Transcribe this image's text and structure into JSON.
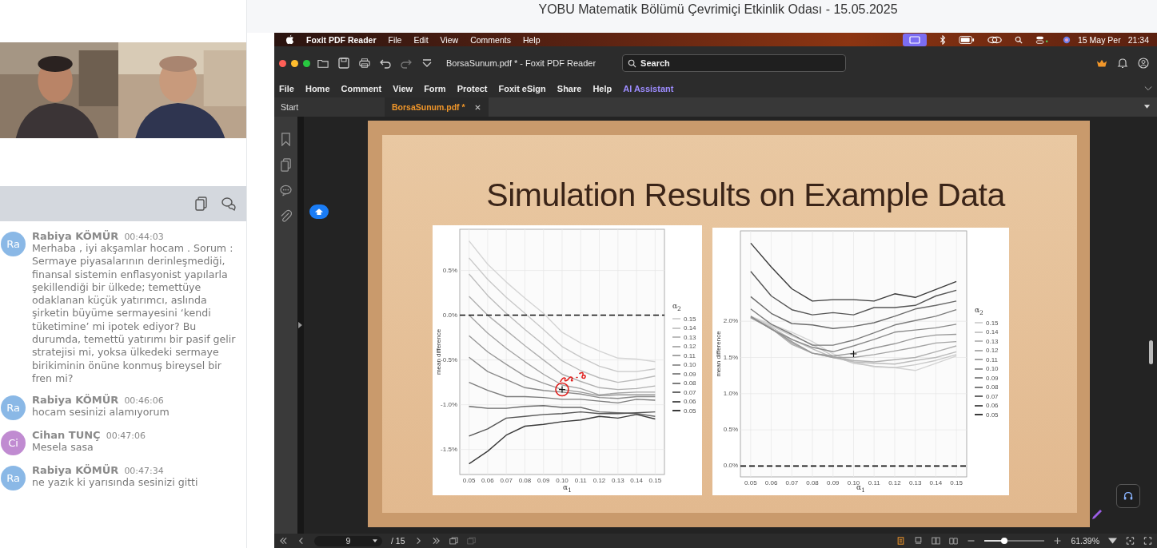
{
  "room_title": "YOBU Matematik Bölümü Çevrimiçi Etkinlik Odası - 15.05.2025",
  "chat": {
    "messages": [
      {
        "initials": "Ra",
        "color": "#8ab8e6",
        "name": "Rabiya KÖMÜR",
        "time": "00:44:03",
        "text": "Merhaba , iyi akşamlar hocam . Sorum : Sermaye piyasalarının derinleşmediği, finansal sistemin enflasyonist yapılarla şekillendiği bir ülkede; temettüye odaklanan küçük yatırımcı, aslında şirketin büyüme sermayesini ‘kendi tüketimine’ mi ipotek ediyor? Bu durumda, temettü yatırımı bir pasif gelir stratejisi mi, yoksa ülkedeki sermaye birikiminin önüne konmuş bireysel bir fren mi?"
      },
      {
        "initials": "Ra",
        "color": "#8ab8e6",
        "name": "Rabiya KÖMÜR",
        "time": "00:46:06",
        "text": "hocam sesinizi alamıyorum"
      },
      {
        "initials": "Ci",
        "color": "#c08bd1",
        "name": "Cihan TUNÇ",
        "time": "00:47:06",
        "text": "Mesela sasa"
      },
      {
        "initials": "Ra",
        "color": "#8ab8e6",
        "name": "Rabiya KÖMÜR",
        "time": "00:47:34",
        "text": "ne yazık ki yarısında sesinizi gitti"
      }
    ]
  },
  "shared_screen": {
    "mac_menu": {
      "app": "Foxit PDF Reader",
      "items": [
        "File",
        "Edit",
        "View",
        "Comments",
        "Help"
      ],
      "date": "15 May Per",
      "time": "21:34"
    },
    "window": {
      "title": "BorsaSunum.pdf * - Foxit PDF Reader",
      "search": {
        "placeholder": "Search"
      }
    },
    "ribbon": [
      {
        "label": "File",
        "kind": "menu"
      },
      {
        "label": "Home",
        "kind": "menu"
      },
      {
        "label": "Comment",
        "kind": "menu"
      },
      {
        "label": "View",
        "kind": "menu"
      },
      {
        "label": "Form",
        "kind": "menu"
      },
      {
        "label": "Protect",
        "kind": "menu"
      },
      {
        "label": "Foxit eSign",
        "kind": "menu"
      },
      {
        "label": "Share",
        "kind": "menu"
      },
      {
        "label": "Help",
        "kind": "menu"
      },
      {
        "label": "AI Assistant",
        "kind": "ai"
      }
    ],
    "tabs": [
      {
        "label": "Start",
        "selected": false,
        "closable": false
      },
      {
        "label": "BorsaSunum.pdf *",
        "selected": true,
        "closable": true
      }
    ],
    "slide": {
      "title": "Simulation Results on Example Data",
      "charts": [
        {
          "chart_data": {
            "type": "line",
            "xlabel": "α$_{1}$",
            "ylabel": "mean difference",
            "legend": true,
            "legend_title": "α$_{2}$",
            "grid": true,
            "ref_lines": [
              {
                "axis": "y",
                "value": 0
              }
            ],
            "x": [
              0.05,
              0.06,
              0.07,
              0.08,
              0.09,
              0.1,
              0.11,
              0.12,
              0.13,
              0.14,
              0.15
            ],
            "xlim": [
              0.045,
              0.155
            ],
            "ylim": [
              -1.78,
              0.96
            ],
            "xticks": [
              {
                "value": 0.05,
                "label": "0.05"
              },
              {
                "value": 0.06,
                "label": "0.06"
              },
              {
                "value": 0.07,
                "label": "0.07"
              },
              {
                "value": 0.08,
                "label": "0.08"
              },
              {
                "value": 0.09,
                "label": "0.09"
              },
              {
                "value": 0.1,
                "label": "0.10"
              },
              {
                "value": 0.11,
                "label": "0.11"
              },
              {
                "value": 0.12,
                "label": "0.12"
              },
              {
                "value": 0.13,
                "label": "0.13"
              },
              {
                "value": 0.14,
                "label": "0.14"
              },
              {
                "value": 0.15,
                "label": "0.15"
              }
            ],
            "yticks": [
              {
                "value": -1.5,
                "label": "-1.5%"
              },
              {
                "value": -1.0,
                "label": "-1.0%"
              },
              {
                "value": -0.5,
                "label": "-0.5%"
              },
              {
                "value": 0,
                "label": "0.0%"
              },
              {
                "value": 0.5,
                "label": "0.5%"
              }
            ],
            "series": [
              {
                "name": "0.15",
                "color": "#d4d4d4",
                "values": [
                  0.83,
                  0.57,
                  0.37,
                  0.19,
                  0.02,
                  -0.19,
                  -0.31,
                  -0.4,
                  -0.48,
                  -0.49,
                  -0.52
                ]
              },
              {
                "name": "0.14",
                "color": "#c8c8c8",
                "values": [
                  0.64,
                  0.4,
                  0.2,
                  0.02,
                  -0.16,
                  -0.35,
                  -0.47,
                  -0.57,
                  -0.63,
                  -0.63,
                  -0.6
                ]
              },
              {
                "name": "0.13",
                "color": "#bcbcbc",
                "values": [
                  0.46,
                  0.22,
                  0.02,
                  -0.16,
                  -0.33,
                  -0.51,
                  -0.62,
                  -0.7,
                  -0.75,
                  -0.72,
                  -0.68
                ]
              },
              {
                "name": "0.12",
                "color": "#b0b0b0",
                "values": [
                  0.21,
                  0.0,
                  -0.17,
                  -0.34,
                  -0.5,
                  -0.66,
                  -0.74,
                  -0.81,
                  -0.83,
                  -0.82,
                  -0.79
                ]
              },
              {
                "name": "0.11",
                "color": "#a4a4a4",
                "values": [
                  0.0,
                  -0.2,
                  -0.37,
                  -0.52,
                  -0.66,
                  -0.78,
                  -0.82,
                  -0.89,
                  -0.87,
                  -0.86,
                  -0.86
                ]
              },
              {
                "name": "0.10",
                "color": "#989898",
                "values": [
                  -0.23,
                  -0.41,
                  -0.55,
                  -0.68,
                  -0.76,
                  -0.83,
                  -0.86,
                  -0.9,
                  -0.89,
                  -0.89,
                  -0.89
                ]
              },
              {
                "name": "0.09",
                "color": "#8a8a8a",
                "values": [
                  -0.47,
                  -0.63,
                  -0.72,
                  -0.81,
                  -0.84,
                  -0.86,
                  -0.88,
                  -0.92,
                  -0.93,
                  -0.91,
                  -0.91
                ]
              },
              {
                "name": "0.08",
                "color": "#7c7c7c",
                "values": [
                  -0.75,
                  -0.84,
                  -0.91,
                  -0.91,
                  -0.92,
                  -0.94,
                  -0.94,
                  -0.96,
                  -0.98,
                  -0.94,
                  -0.95
                ]
              },
              {
                "name": "0.07",
                "color": "#6a6a6a",
                "values": [
                  -1.02,
                  -1.04,
                  -1.04,
                  -1.02,
                  -1.01,
                  -1.03,
                  -1.03,
                  -1.08,
                  -1.09,
                  -1.1,
                  -1.13
                ]
              },
              {
                "name": "0.06",
                "color": "#555555",
                "values": [
                  -1.35,
                  -1.27,
                  -1.15,
                  -1.13,
                  -1.11,
                  -1.1,
                  -1.08,
                  -1.1,
                  -1.1,
                  -1.09,
                  -1.08
                ]
              },
              {
                "name": "0.05",
                "color": "#3a3a3a",
                "values": [
                  -1.66,
                  -1.52,
                  -1.34,
                  -1.24,
                  -1.22,
                  -1.19,
                  -1.17,
                  -1.13,
                  -1.15,
                  -1.11,
                  -1.16
                ]
              }
            ]
          }
        },
        {
          "chart_data": {
            "type": "line",
            "xlabel": "α$_{1}$",
            "ylabel": "mean difference",
            "legend": true,
            "legend_title": "α$_{2}$",
            "grid": true,
            "ref_lines": [
              {
                "axis": "y",
                "value": 0
              }
            ],
            "x": [
              0.05,
              0.06,
              0.07,
              0.08,
              0.09,
              0.1,
              0.11,
              0.12,
              0.13,
              0.14,
              0.15
            ],
            "xlim": [
              0.045,
              0.155
            ],
            "ylim": [
              -0.15,
              3.25
            ],
            "xticks": [
              {
                "value": 0.05,
                "label": "0.05"
              },
              {
                "value": 0.06,
                "label": "0.06"
              },
              {
                "value": 0.07,
                "label": "0.07"
              },
              {
                "value": 0.08,
                "label": "0.08"
              },
              {
                "value": 0.09,
                "label": "0.09"
              },
              {
                "value": 0.1,
                "label": "0.10"
              },
              {
                "value": 0.11,
                "label": "0.11"
              },
              {
                "value": 0.12,
                "label": "0.12"
              },
              {
                "value": 0.13,
                "label": "0.13"
              },
              {
                "value": 0.14,
                "label": "0.14"
              },
              {
                "value": 0.15,
                "label": "0.15"
              }
            ],
            "yticks": [
              {
                "value": 0,
                "label": "0.0%"
              },
              {
                "value": 0.5,
                "label": "0.5%"
              },
              {
                "value": 1.0,
                "label": "1.0%"
              },
              {
                "value": 1.5,
                "label": "1.5%"
              },
              {
                "value": 2.0,
                "label": "2.0%"
              }
            ],
            "series": [
              {
                "name": "0.15",
                "color": "#d4d4d4",
                "values": [
                  2.07,
                  1.96,
                  1.85,
                  1.72,
                  1.55,
                  1.44,
                  1.37,
                  1.36,
                  1.32,
                  1.42,
                  1.52
                ]
              },
              {
                "name": "0.14",
                "color": "#c8c8c8",
                "values": [
                  2.06,
                  1.94,
                  1.8,
                  1.68,
                  1.52,
                  1.42,
                  1.38,
                  1.36,
                  1.4,
                  1.46,
                  1.54
                ]
              },
              {
                "name": "0.13",
                "color": "#bcbcbc",
                "values": [
                  2.05,
                  1.92,
                  1.75,
                  1.62,
                  1.5,
                  1.44,
                  1.42,
                  1.41,
                  1.46,
                  1.5,
                  1.58
                ]
              },
              {
                "name": "0.12",
                "color": "#b0b0b0",
                "values": [
                  2.05,
                  1.9,
                  1.68,
                  1.56,
                  1.5,
                  1.46,
                  1.44,
                  1.47,
                  1.5,
                  1.58,
                  1.66
                ]
              },
              {
                "name": "0.11",
                "color": "#a4a4a4",
                "values": [
                  2.05,
                  1.9,
                  1.7,
                  1.56,
                  1.5,
                  1.5,
                  1.54,
                  1.59,
                  1.64,
                  1.7,
                  1.72
                ]
              },
              {
                "name": "0.10",
                "color": "#989898",
                "values": [
                  2.06,
                  1.9,
                  1.72,
                  1.56,
                  1.52,
                  1.56,
                  1.63,
                  1.69,
                  1.77,
                  1.81,
                  1.82
                ]
              },
              {
                "name": "0.09",
                "color": "#8a8a8a",
                "values": [
                  2.07,
                  1.89,
                  1.75,
                  1.64,
                  1.58,
                  1.66,
                  1.75,
                  1.85,
                  1.88,
                  1.91,
                  1.96
                ]
              },
              {
                "name": "0.08",
                "color": "#7c7c7c",
                "values": [
                  2.17,
                  1.96,
                  1.82,
                  1.67,
                  1.67,
                  1.74,
                  1.84,
                  1.95,
                  2.01,
                  2.07,
                  2.16
                ]
              },
              {
                "name": "0.07",
                "color": "#6a6a6a",
                "values": [
                  2.34,
                  2.11,
                  1.97,
                  1.95,
                  1.9,
                  1.93,
                  1.98,
                  2.07,
                  2.17,
                  2.22,
                  2.28
                ]
              },
              {
                "name": "0.06",
                "color": "#555555",
                "values": [
                  2.69,
                  2.35,
                  2.16,
                  2.09,
                  2.12,
                  2.09,
                  2.19,
                  2.19,
                  2.22,
                  2.35,
                  2.43
                ]
              },
              {
                "name": "0.05",
                "color": "#3a3a3a",
                "values": [
                  3.08,
                  2.75,
                  2.45,
                  2.28,
                  2.3,
                  2.3,
                  2.28,
                  2.38,
                  2.33,
                  2.44,
                  2.55
                ]
              }
            ]
          }
        }
      ]
    },
    "status_bar": {
      "page": "9",
      "page_count": "/ 15",
      "zoom_slider": {
        "level": 0.33
      },
      "zoom": "61.39%"
    }
  }
}
